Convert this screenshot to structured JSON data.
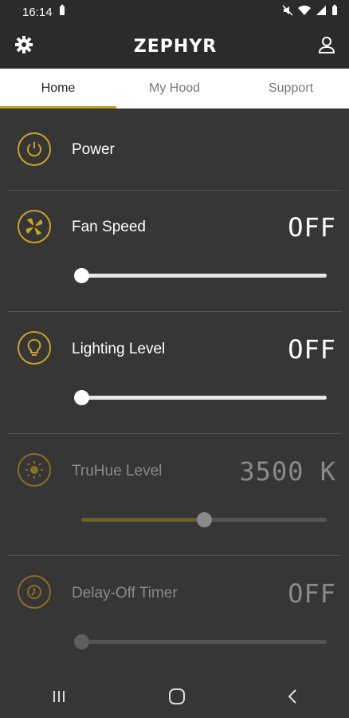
{
  "status": {
    "time": "16:14"
  },
  "app": {
    "brand": "ZEPHYR"
  },
  "tabs": [
    {
      "label": "Home",
      "active": true
    },
    {
      "label": "My Hood",
      "active": false
    },
    {
      "label": "Support",
      "active": false
    }
  ],
  "controls": {
    "power": {
      "label": "Power",
      "icon": "power-icon"
    },
    "fan": {
      "label": "Fan Speed",
      "value": "OFF",
      "slider_fraction": 0.0,
      "icon": "fan-icon"
    },
    "lighting": {
      "label": "Lighting Level",
      "value": "OFF",
      "slider_fraction": 0.0,
      "icon": "bulb-icon"
    },
    "truhue": {
      "label": "TruHue Level",
      "value": "3500 K",
      "slider_fraction": 0.5,
      "icon": "sun-icon",
      "enabled": false
    },
    "timer": {
      "label": "Delay-Off Timer",
      "value": "OFF",
      "slider_fraction": 0.0,
      "icon": "timer-icon",
      "enabled": false
    }
  },
  "colors": {
    "accent": "#c9a227",
    "background": "#363636",
    "bar": "#2b2b2b"
  }
}
